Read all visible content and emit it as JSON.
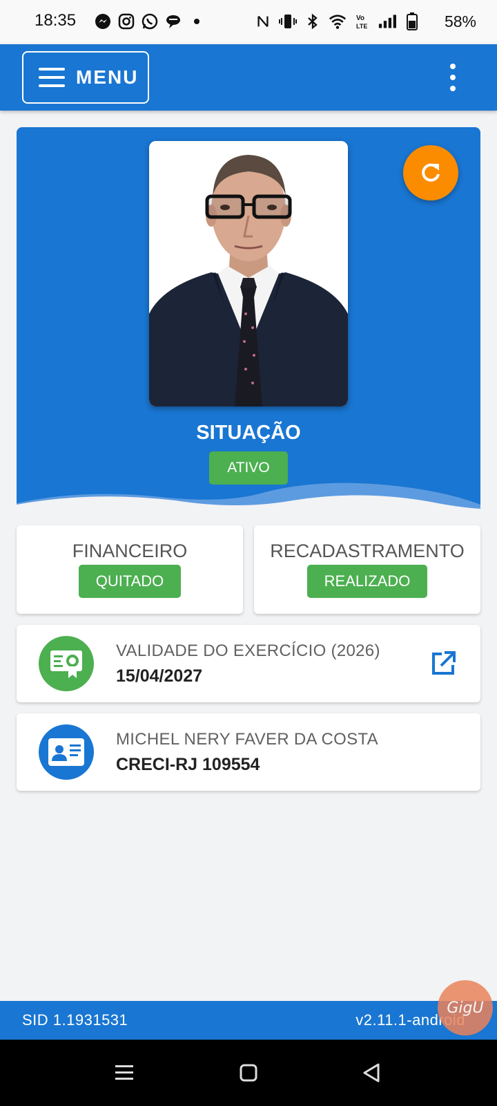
{
  "status_bar": {
    "time": "18:35",
    "battery_percent": "58%",
    "left_icons": [
      "messenger-icon",
      "instagram-icon",
      "whatsapp-icon",
      "chat-bubble-icon",
      "dot-icon"
    ],
    "right_icons": [
      "nfc-icon",
      "vibrate-icon",
      "bluetooth-icon",
      "wifi-icon",
      "volte-icon",
      "signal-icon",
      "battery-icon"
    ]
  },
  "appbar": {
    "menu_label": "MENU"
  },
  "hero": {
    "situacao_label": "SITUAÇÃO",
    "situacao_status": "ATIVO"
  },
  "cards": {
    "financeiro": {
      "title": "FINANCEIRO",
      "status": "QUITADO"
    },
    "recadastramento": {
      "title": "RECADASTRAMENTO",
      "status": "REALIZADO"
    }
  },
  "validade": {
    "label": "VALIDADE DO EXERCÍCIO (2026)",
    "value": "15/04/2027"
  },
  "profile": {
    "name": "MICHEL NERY FAVER DA COSTA",
    "registration": "CRECI-RJ 109554"
  },
  "footer": {
    "sid": "SID 1.1931531",
    "version": "v2.11.1-android"
  },
  "overlay": {
    "badge_text": "GigU"
  },
  "colors": {
    "primary": "#1976d2",
    "accent": "#fb8c00",
    "success": "#4caf50"
  }
}
